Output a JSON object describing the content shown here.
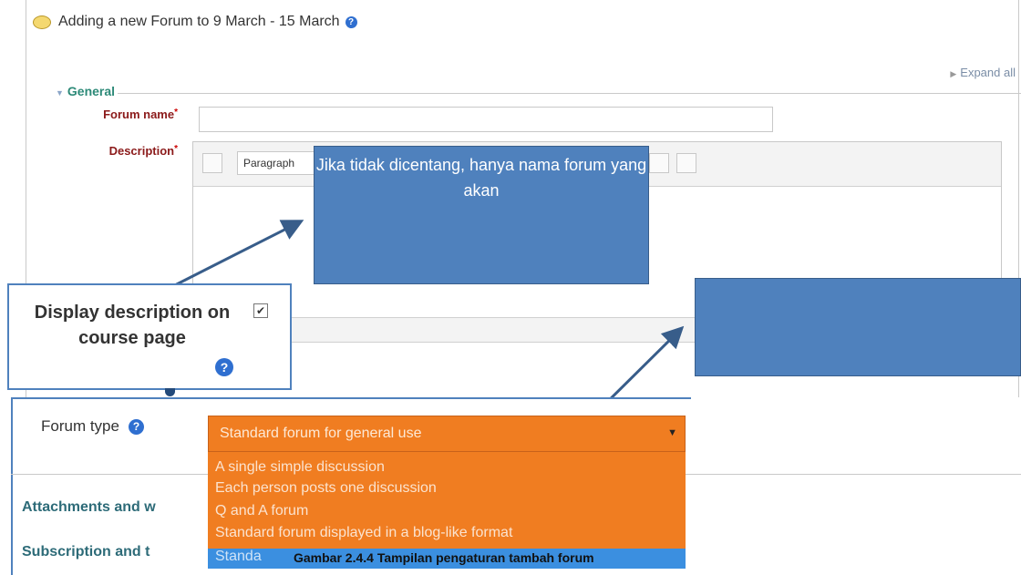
{
  "header": {
    "title": "Adding a new Forum to 9 March - 15 March",
    "help_icon": "help-icon"
  },
  "expand_all": "Expand all",
  "section": {
    "legend": "General"
  },
  "fields": {
    "forum_name_label": "Forum name",
    "forum_name_value": "",
    "description_label": "Description",
    "required_mark": "*"
  },
  "editor": {
    "paragraph_select": "Paragraph"
  },
  "callouts": {
    "top": "Jika tidak dicentang, hanya nama forum yang akan"
  },
  "display_description": {
    "label": "Display description on course page",
    "checked": true
  },
  "forum_type": {
    "label": "Forum type",
    "selected": "Standard forum for general use",
    "options": [
      "A single simple discussion",
      "Each person posts one discussion",
      "Q and A forum",
      "Standard forum displayed in a blog-like format",
      "Standa"
    ]
  },
  "sections": {
    "attachments": "Attachments and w",
    "subscription": "Subscription and t"
  },
  "caption": "Gambar 2.4.4 Tampilan pengaturan tambah forum",
  "colors": {
    "callout": "#4f81bd",
    "dropdown": "#f07d21",
    "selected_option": "#3b8fe0",
    "legend": "#2d8a78"
  }
}
